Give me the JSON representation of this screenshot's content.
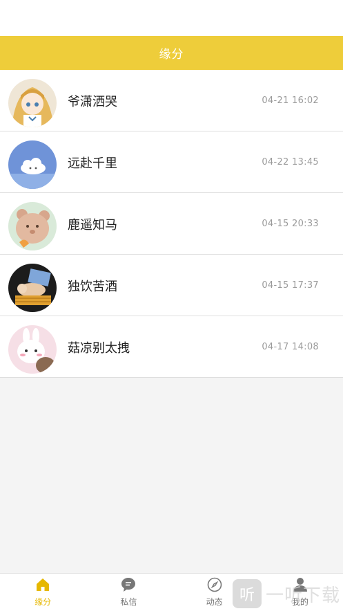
{
  "header": {
    "title": "缘分"
  },
  "matches": [
    {
      "name": "爷潇洒哭",
      "time": "04-21 16:02",
      "avatar": "anime-girl-avatar"
    },
    {
      "name": "远赴千里",
      "time": "04-22 13:45",
      "avatar": "cloud-sky-avatar"
    },
    {
      "name": "鹿遥知马",
      "time": "04-15 20:33",
      "avatar": "bear-avatar"
    },
    {
      "name": "独饮苦酒",
      "time": "04-15 17:37",
      "avatar": "sleeping-dog-avatar"
    },
    {
      "name": "菇凉别太拽",
      "time": "04-17 14:08",
      "avatar": "bunny-avatar"
    }
  ],
  "tabbar": {
    "tabs": [
      {
        "label": "缘分",
        "icon": "home-icon",
        "active": true
      },
      {
        "label": "私信",
        "icon": "chat-icon",
        "active": false
      },
      {
        "label": "动态",
        "icon": "compass-icon",
        "active": false
      },
      {
        "label": "我的",
        "icon": "user-icon",
        "active": false
      }
    ]
  },
  "watermark": {
    "glyph": "听",
    "text": "一听下载"
  },
  "colors": {
    "accent": "#eecd3a",
    "active_tab": "#e6b800"
  }
}
